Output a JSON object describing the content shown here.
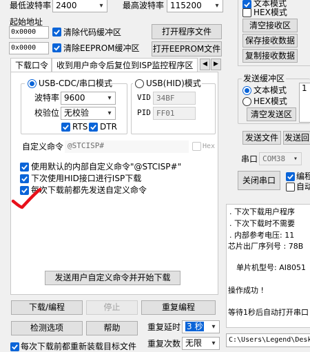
{
  "top": {
    "min_baud_label": "最低波特率",
    "min_baud_value": "2400",
    "max_baud_label": "最高波特率",
    "max_baud_value": "115200",
    "start_addr_label": "起始地址",
    "addr1": "0x0000",
    "clear_code_label": "清除代码缓冲区",
    "open_program_button": "打开程序文件",
    "addr2": "0x0000",
    "clear_eeprom_label": "清除EEPROM缓冲区",
    "open_eeprom_button": "打开EEPROM文件"
  },
  "tabs": {
    "tab1": "下载口令",
    "tab2": "收到用户命令后复位到ISP监控程序区"
  },
  "panel": {
    "usb_cdc_label": "USB-CDC/串口模式",
    "usb_hid_label": "USB(HID)模式",
    "baud_label": "波特率",
    "baud_value": "9600",
    "parity_label": "校验位",
    "parity_value": "无校验",
    "rts_label": "RTS",
    "dtr_label": "DTR",
    "vid_label": "VID",
    "vid_value": "34BF",
    "pid_label": "PID",
    "pid_value": "FF01",
    "custom_cmd_label": "自定义命令",
    "custom_cmd_value": "@STCISP#",
    "hex_label": "Hex",
    "opt1": "使用默认的内部自定义命令\"@STCISP#\"",
    "opt2": "下次使用HID接口进行ISP下载",
    "opt3": "每次下载前都先发送自定义命令",
    "send_button": "发送用户自定义命令并开始下载"
  },
  "bottom": {
    "download_button": "下载/编程",
    "stop_button": "停止",
    "reprogram_button": "重复编程",
    "check_button": "检测选项",
    "help_button": "帮助",
    "delay_label": "重复延时",
    "delay_value": "3 秒",
    "count_label": "重复次数",
    "count_value": "无限",
    "reload_label": "每次下载前都重新装载目标文件"
  },
  "right": {
    "recv_opt1": "文本模式",
    "recv_hex": "HEX模式",
    "clear_recv_button": "清空接收区",
    "save_recv_button": "保存接收数据",
    "copy_recv_button": "复制接收数据",
    "send_buffer_label": "发送缓冲区",
    "send_text_mode": "文本模式",
    "send_hex_mode": "HEX模式",
    "clear_send_button": "清空发送区",
    "send_area_value": "1",
    "send_file_button": "发送文件",
    "send_return_button": "发送回",
    "port_label": "串口",
    "port_value": "COM38",
    "close_port_button": "关闭串口",
    "encode_label": "编程",
    "auto_label": "自动",
    "log_lines": [
      ". 下次下载用户程序",
      ". 下次下载时不需要",
      ". 内部参考电压: 11",
      "芯片出厂序列号 : 78B",
      "",
      "单片机型号: AI8051",
      "",
      "操作成功 !",
      "",
      "等待1秒后自动打开串口"
    ],
    "path_value": "C:\\Users\\Legend\\Desk"
  }
}
